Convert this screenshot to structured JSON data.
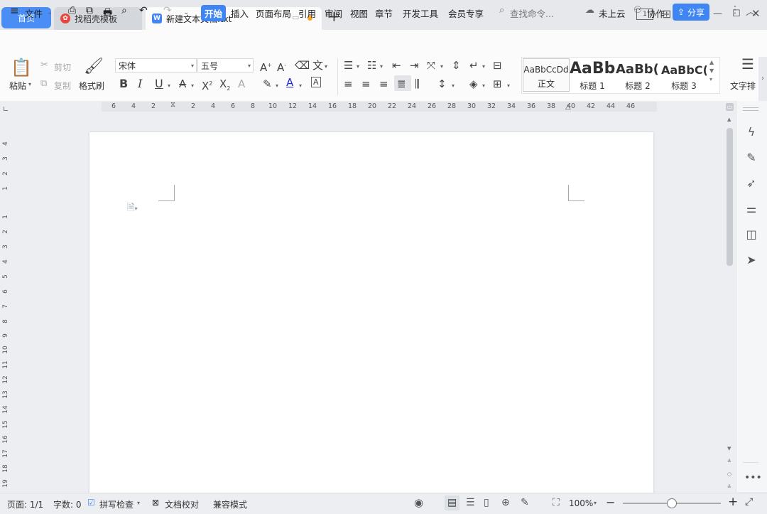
{
  "tabs": {
    "home": "首页",
    "template": "找稻壳模板",
    "document": "新建文本文档.txt"
  },
  "menu": {
    "file": "文件",
    "start": "开始",
    "insert": "插入",
    "layout": "页面布局",
    "references": "引用",
    "review": "审阅",
    "view": "视图",
    "chapter": "章节",
    "devtools": "开发工具",
    "member": "会员专享",
    "search_placeholder": "查找命令...",
    "cloud": "未上云",
    "collab": "协作",
    "share": "分享"
  },
  "ribbon": {
    "paste": "粘贴",
    "cut": "剪切",
    "copy": "复制",
    "format_painter": "格式刷",
    "font_name": "宋体",
    "font_size": "五号",
    "text_layout": "文字排",
    "styles": [
      {
        "preview": "AaBbCcDd",
        "label": "正文"
      },
      {
        "preview": "AaBb",
        "label": "标题 1"
      },
      {
        "preview": "AaBb(",
        "label": "标题 2"
      },
      {
        "preview": "AaBbC(",
        "label": "标题 3"
      }
    ]
  },
  "ruler": {
    "h_ticks": [
      "6",
      "4",
      "2",
      "2",
      "4",
      "6",
      "8",
      "10",
      "12",
      "14",
      "16",
      "18",
      "20",
      "22",
      "24",
      "26",
      "28",
      "30",
      "32",
      "34",
      "36",
      "38",
      "40",
      "42",
      "44",
      "46"
    ],
    "v_ticks": [
      "4",
      "3",
      "2",
      "1",
      "1",
      "2",
      "3",
      "4",
      "5",
      "6",
      "7",
      "8",
      "9",
      "10",
      "11",
      "12",
      "13",
      "14",
      "15",
      "16",
      "17",
      "18",
      "19"
    ]
  },
  "status": {
    "page": "页面: 1/1",
    "words": "字数: 0",
    "spell": "拼写检查",
    "proof": "文档校对",
    "compat": "兼容模式",
    "zoom": "100%"
  },
  "colors": {
    "accent": "#3f86f2",
    "tab_home": "#4a8ef5",
    "unsaved_dot": "#f5a623",
    "template_icon": "#e8453c"
  }
}
